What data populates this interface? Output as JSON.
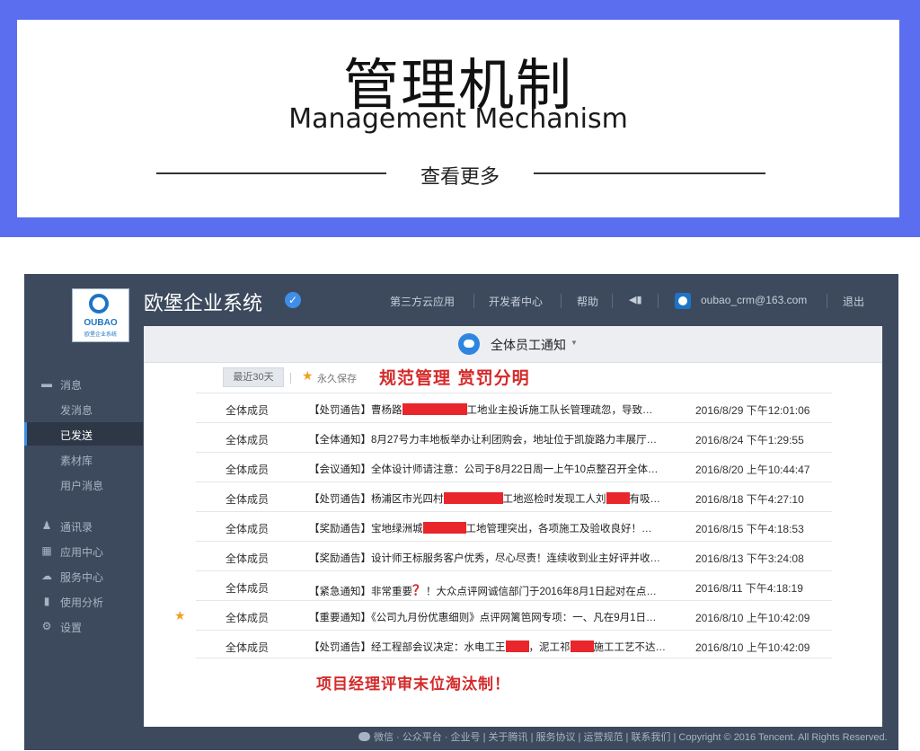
{
  "banner": {
    "title_cn": "管理机制",
    "title_en": "Management Mechanism",
    "more": "查看更多"
  },
  "app": {
    "logo_word": "OUBAO",
    "logo_sub": "欧堡企业系统",
    "brand": "欧堡企业系统",
    "nav": {
      "third_party": "第三方云应用",
      "developer": "开发者中心",
      "help": "帮助",
      "account": "oubao_crm@163.com",
      "logout": "退出"
    },
    "sidebar": {
      "messages": "消息",
      "send": "发消息",
      "sent": "已发送",
      "materials": "素材库",
      "user_messages": "用户消息",
      "contacts": "通讯录",
      "apps": "应用中心",
      "service": "服务中心",
      "analytics": "使用分析",
      "settings": "设置"
    },
    "channel": "全体员工通知",
    "filters": {
      "recent": "最近30天",
      "forever": "永久保存"
    },
    "headline": "规范管理  赏罚分明",
    "messages": [
      {
        "recipient": "全体成员",
        "subject_a": "【处罚通告】曹杨路",
        "subject_b": "工地业主投诉施工队长管理疏忽，导致…",
        "time": "2016/8/29 下午12:01:06"
      },
      {
        "recipient": "全体成员",
        "subject": "【全体通知】8月27号力丰地板举办让利团购会，地址位于凯旋路力丰展厅…",
        "time": "2016/8/24 下午1:29:55"
      },
      {
        "recipient": "全体成员",
        "subject": "【会议通知】全体设计师请注意：公司于8月22日周一上午10点整召开全体…",
        "time": "2016/8/20 上午10:44:47"
      },
      {
        "recipient": "全体成员",
        "subject_a": "【处罚通告】杨浦区市光四村",
        "subject_b": "工地巡检时发现工人刘",
        "subject_c": "有吸…",
        "time": "2016/8/18 下午4:27:10"
      },
      {
        "recipient": "全体成员",
        "subject_a": "【奖励通告】宝地绿洲城",
        "subject_b": "工地管理突出，各项施工及验收良好！…",
        "time": "2016/8/15 下午4:18:53"
      },
      {
        "recipient": "全体成员",
        "subject": "【奖励通告】设计师王标服务客户优秀，尽心尽责！连续收到业主好评并收…",
        "time": "2016/8/13 下午3:24:08"
      },
      {
        "recipient": "全体成员",
        "subject_a": "【紧急通知】非常重要",
        "qmark": "？",
        "subject_b": "！大众点评网诚信部门于2016年8月1日起对在点…",
        "time": "2016/8/11 下午4:18:19"
      },
      {
        "recipient": "全体成员",
        "subject": "【重要通知】《公司九月份优惠细则》点评网篱笆网专项：一、凡在9月1日…",
        "time": "2016/8/10 上午10:42:09"
      },
      {
        "recipient": "全体成员",
        "subject_a": "【处罚通告】经工程部会议决定：水电工王",
        "subject_b": "，泥工祁",
        "subject_c": "施工工艺不达…",
        "time": "2016/8/10 上午10:42:09"
      }
    ],
    "footer_slogan": "项目经理评审末位淘汰制！",
    "copyright": "微信 · 公众平台 · 企业号 | 关于腾讯 | 服务协议 | 运营规范 | 联系我们 | Copyright © 2016 Tencent. All Rights Reserved."
  },
  "colors": {
    "banner_bg": "#5b6ef0",
    "app_bg": "#3d4a5e",
    "accent_blue": "#2f86e0",
    "highlight_red": "#d42a2a",
    "redaction": "#e8262c",
    "star": "#f0a020"
  }
}
